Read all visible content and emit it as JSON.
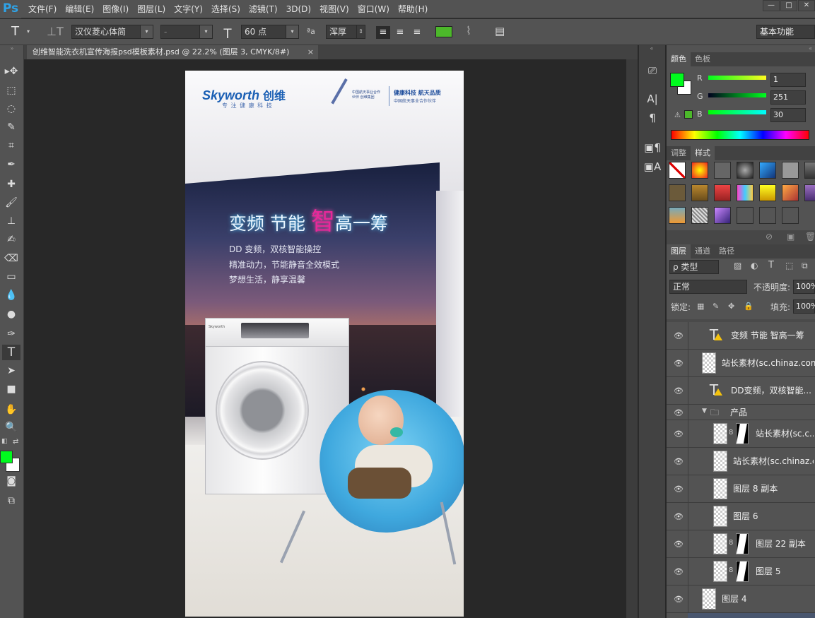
{
  "app": {
    "logo": "Ps"
  },
  "menu": [
    "文件(F)",
    "编辑(E)",
    "图像(I)",
    "图层(L)",
    "文字(Y)",
    "选择(S)",
    "滤镜(T)",
    "3D(D)",
    "视图(V)",
    "窗口(W)",
    "帮助(H)"
  ],
  "window_controls": {
    "minimize": "—",
    "maximize": "□",
    "close": "✕"
  },
  "options": {
    "font_family": "汉仪菱心体简",
    "font_style": "-",
    "font_size": "60 点",
    "antialias_glyph": "ªa",
    "antialias": "浑厚",
    "text_color": "#4cb82a",
    "workspace": "基本功能"
  },
  "document_tab": {
    "title": "创维智能洗衣机宣传海报psd模板素材.psd @ 22.2% (图层 3, CMYK/8#)",
    "close": "×"
  },
  "poster": {
    "brand": "Skyworth",
    "brand_cn": "创维",
    "brand_slogan": "专 注 健 康 科 技",
    "partner_title": "健康科技 航天品质",
    "partner_sub": "中国航天事业合作伙伴",
    "partner_logo_text": "中国航天事业合作伙伴 创维集团",
    "headline_a": "变频 节能 ",
    "headline_b": "智",
    "headline_c": "高一筹",
    "line1": "DD 变频，双核智能操控",
    "line2": "精准动力，节能静音全效模式",
    "line3": "梦想生活，静享温馨",
    "washer_brand": "Skyworth"
  },
  "color_panel": {
    "tabs": [
      "颜色",
      "色板"
    ],
    "fg": "#00fb1e",
    "bg": "#ffffff",
    "channels": [
      {
        "label": "R",
        "value": "1"
      },
      {
        "label": "G",
        "value": "251"
      },
      {
        "label": "B",
        "value": "30"
      }
    ]
  },
  "style_panel": {
    "tabs": [
      "调整",
      "样式"
    ]
  },
  "layers_panel": {
    "tabs": [
      "图层",
      "通道",
      "路径"
    ],
    "filter_kind": "ρ 类型",
    "blend_mode": "正常",
    "opacity_label": "不透明度:",
    "opacity": "100%",
    "lock_label": "锁定:",
    "fill_label": "填充:",
    "fill": "100%",
    "layers": [
      {
        "name": "变频 节能  智高一筹",
        "kind": "text"
      },
      {
        "name": "站长素材(sc.chinaz.com)",
        "kind": "pixel"
      },
      {
        "name": "DD变频，双核智能...",
        "kind": "text"
      },
      {
        "name": "产品",
        "kind": "group"
      },
      {
        "name": "站长素材(sc.c...",
        "kind": "masked"
      },
      {
        "name": "站长素材(sc.chinaz.c...",
        "kind": "pixel"
      },
      {
        "name": "图层 8 副本",
        "kind": "pixel"
      },
      {
        "name": "图层 6",
        "kind": "pixel"
      },
      {
        "name": "图层 22 副本",
        "kind": "masked"
      },
      {
        "name": "图层 5",
        "kind": "masked"
      },
      {
        "name": "图层 4",
        "kind": "pixel"
      }
    ]
  }
}
